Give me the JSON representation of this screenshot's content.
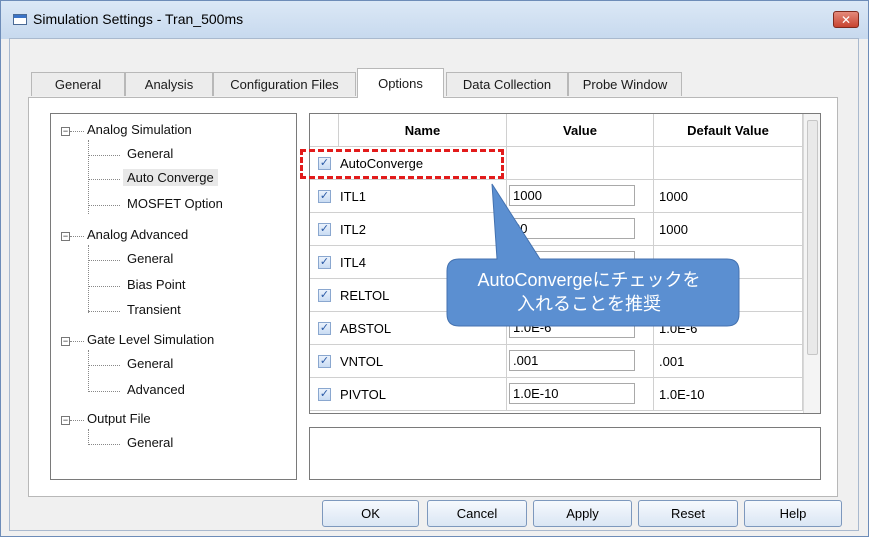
{
  "window": {
    "title": "Simulation Settings - Tran_500ms",
    "close_label": "✕"
  },
  "tabs": [
    {
      "label": "General",
      "active": false
    },
    {
      "label": "Analysis",
      "active": false
    },
    {
      "label": "Configuration Files",
      "active": false
    },
    {
      "label": "Options",
      "active": true
    },
    {
      "label": "Data Collection",
      "active": false
    },
    {
      "label": "Probe Window",
      "active": false
    }
  ],
  "tree": {
    "analog_simulation": {
      "label": "Analog Simulation",
      "children": [
        "General",
        "Auto Converge",
        "MOSFET Option"
      ],
      "selected": "Auto Converge"
    },
    "analog_advanced": {
      "label": "Analog Advanced",
      "children": [
        "General",
        "Bias Point",
        "Transient"
      ]
    },
    "gate_level": {
      "label": "Gate Level Simulation",
      "children": [
        "General",
        "Advanced"
      ]
    },
    "output_file": {
      "label": "Output File",
      "children": [
        "General"
      ]
    }
  },
  "grid": {
    "headers": [
      "Name",
      "Value",
      "Default Value"
    ],
    "rows": [
      {
        "name": "AutoConverge",
        "value": "",
        "default": "",
        "checked": true
      },
      {
        "name": "ITL1",
        "value": "1000",
        "default": "1000",
        "checked": true
      },
      {
        "name": "ITL2",
        "value": "20",
        "default": "1000",
        "checked": true
      },
      {
        "name": "ITL4",
        "value": "",
        "default": "",
        "checked": true
      },
      {
        "name": "RELTOL",
        "value": "",
        "default": "",
        "checked": true
      },
      {
        "name": "ABSTOL",
        "value": "1.0E-6",
        "default": "1.0E-6",
        "checked": true
      },
      {
        "name": "VNTOL",
        "value": ".001",
        "default": ".001",
        "checked": true
      },
      {
        "name": "PIVTOL",
        "value": "1.0E-10",
        "default": "1.0E-10",
        "checked": true
      }
    ]
  },
  "buttons": {
    "ok": "OK",
    "cancel": "Cancel",
    "apply": "Apply",
    "reset": "Reset",
    "help": "Help"
  },
  "callout": {
    "line1": "AutoConvergeにチェックを",
    "line2": "入れることを推奨",
    "color": "#5b8fd1",
    "highlight_color": "#e21b1b"
  },
  "checkmark": "✓",
  "tree_expander": "−"
}
